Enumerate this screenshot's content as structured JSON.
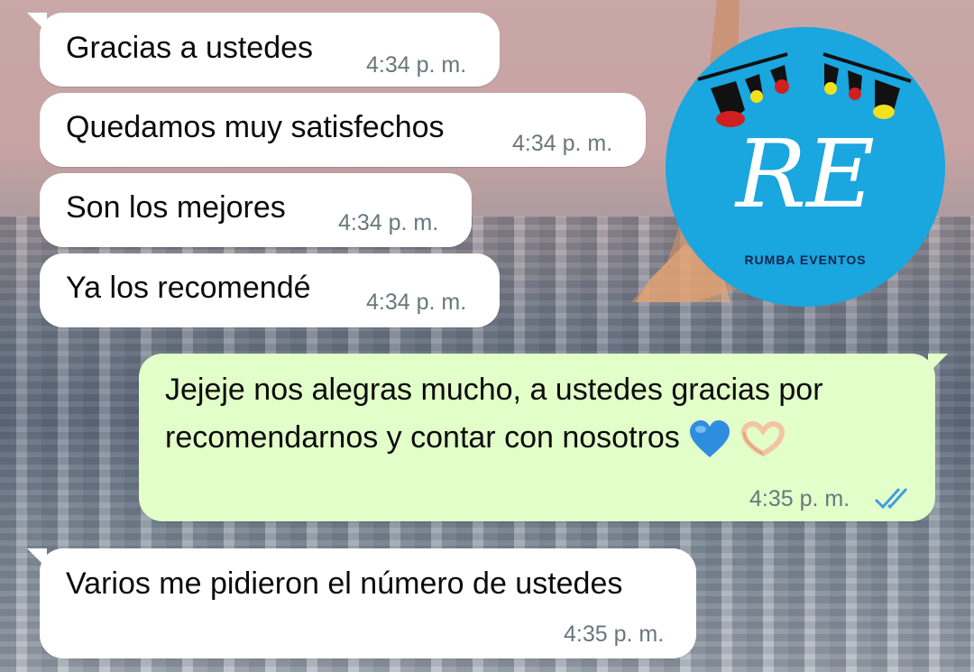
{
  "chat": {
    "messages": [
      {
        "direction": "incoming",
        "text": "Gracias a ustedes",
        "time": "4:34 p. m."
      },
      {
        "direction": "incoming",
        "text": "Quedamos muy satisfechos",
        "time": "4:34 p. m."
      },
      {
        "direction": "incoming",
        "text": "Son los mejores",
        "time": "4:34 p. m."
      },
      {
        "direction": "incoming",
        "text": "Ya los recomendé",
        "time": "4:34 p. m."
      },
      {
        "direction": "outgoing",
        "text_line1": "Jejeje nos alegras mucho, a ustedes gracias por",
        "text_line2": "recomendarnos y contar con nosotros",
        "emojis": [
          "blue-heart",
          "heart-hands"
        ],
        "time": "4:35 p. m.",
        "status": "read"
      },
      {
        "direction": "incoming",
        "text": "Varios me pidieron el número de ustedes",
        "time": "4:35 p. m."
      }
    ]
  },
  "sticker": {
    "brand_text": "RUMBA EVENTOS",
    "monogram": "RE",
    "background_color": "#1aa6de"
  },
  "colors": {
    "incoming_bubble": "#ffffff",
    "outgoing_bubble": "#e2fec9",
    "read_ticks": "#3f9de0"
  }
}
